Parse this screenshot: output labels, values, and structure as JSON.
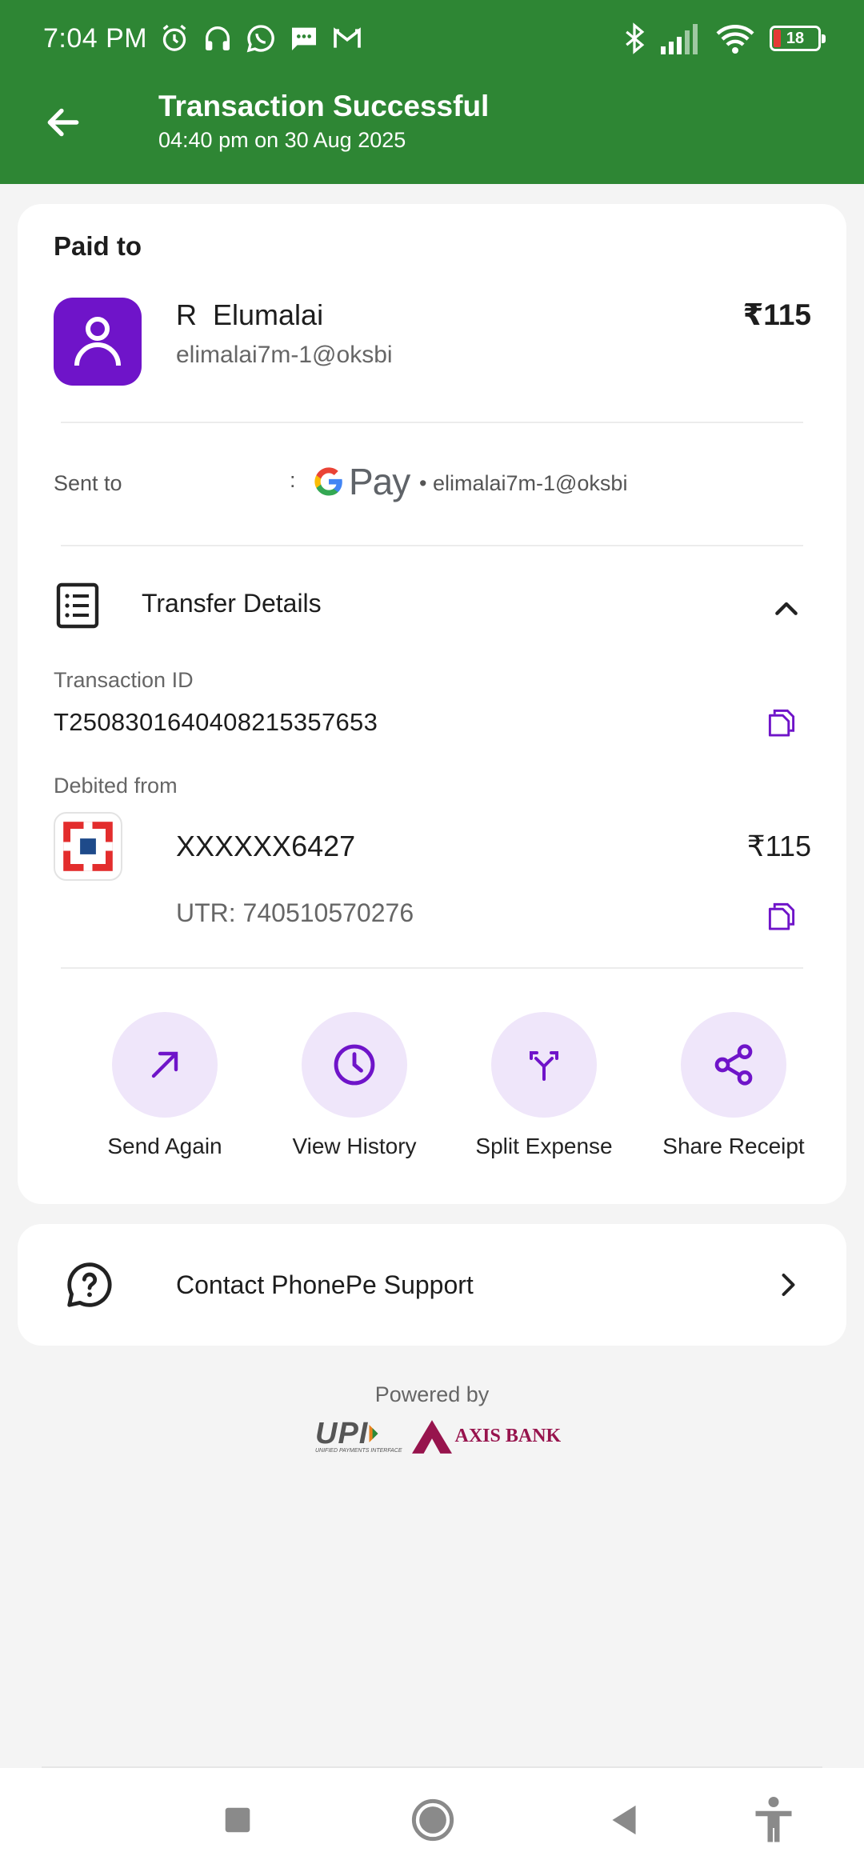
{
  "status_bar": {
    "time": "7:04 PM",
    "battery": "18",
    "left_icons": [
      "alarm-icon",
      "headphones-icon",
      "whatsapp-icon",
      "message-icon",
      "gmail-icon"
    ],
    "right_icons": [
      "bluetooth-icon",
      "signal-icon",
      "wifi-icon",
      "battery-icon"
    ]
  },
  "header": {
    "title": "Transaction Successful",
    "subtitle": "04:40 pm on 30 Aug 2025",
    "background_color": "#2e8634"
  },
  "payee": {
    "section_label": "Paid to",
    "name": "R  Elumalai",
    "upi_id": "elimalai7m-1@oksbi",
    "amount": "₹115",
    "avatar_color": "#6f14c9"
  },
  "sent_to": {
    "label": "Sent to",
    "separator": ":",
    "app_logo_text": "Pay",
    "upi": "• elimalai7m-1@oksbi"
  },
  "transfer_details": {
    "title": "Transfer Details",
    "transaction_id_label": "Transaction ID",
    "transaction_id": "T2508301640408215357653",
    "debited_from_label": "Debited from",
    "account_number": "XXXXXX6427",
    "amount": "₹115",
    "utr": "UTR: 740510570276"
  },
  "actions": [
    {
      "label": "Send Again",
      "icon": "arrow-up-right-icon"
    },
    {
      "label": "View History",
      "icon": "clock-icon"
    },
    {
      "label": "Split Expense",
      "icon": "split-icon"
    },
    {
      "label": "Share Receipt",
      "icon": "share-icon"
    }
  ],
  "support": {
    "label": "Contact PhonePe Support"
  },
  "footer": {
    "powered_by": "Powered by",
    "upi_logo_text": "UPI",
    "upi_logo_subtext": "UNIFIED PAYMENTS INTERFACE",
    "bank_logo_text": "AXIS BANK"
  },
  "colors": {
    "accent_purple": "#6f14c9",
    "action_bg": "#efe6fa",
    "bank_red": "#97144d"
  }
}
